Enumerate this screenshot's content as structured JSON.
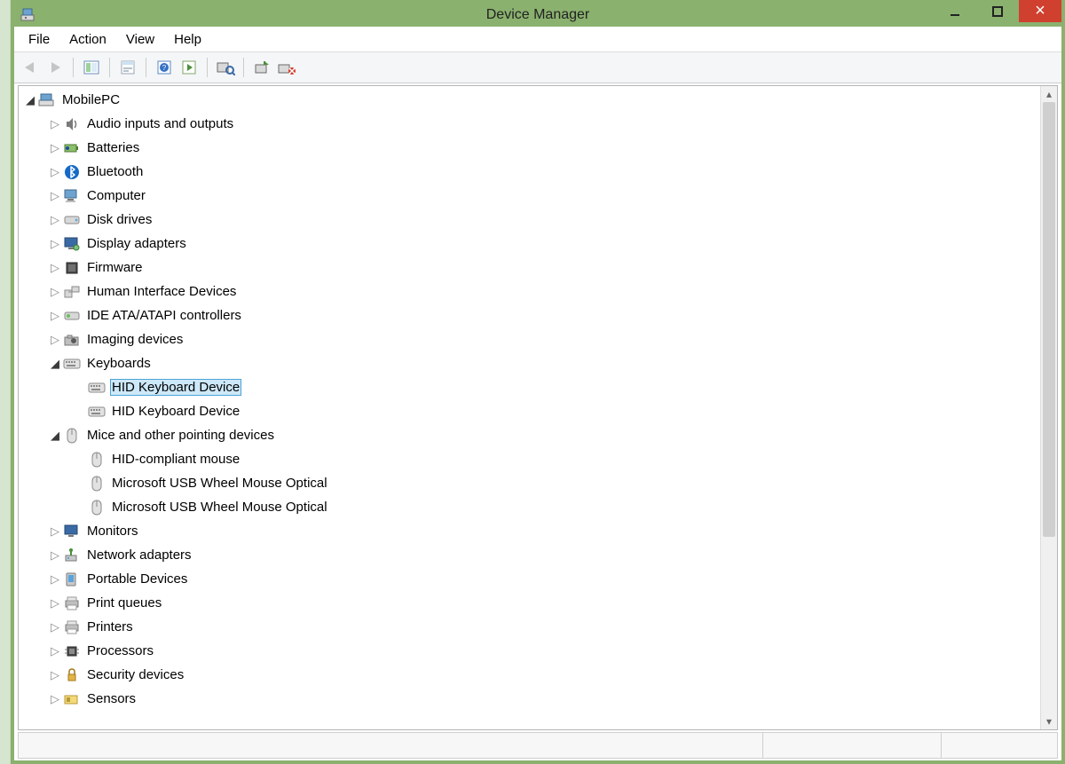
{
  "window": {
    "title": "Device Manager"
  },
  "menus": {
    "file": "File",
    "action": "Action",
    "view": "View",
    "help": "Help"
  },
  "tree": {
    "root": "MobilePC",
    "items": [
      {
        "label": "Audio inputs and outputs",
        "icon": "speaker",
        "state": "collapsed"
      },
      {
        "label": "Batteries",
        "icon": "battery",
        "state": "collapsed"
      },
      {
        "label": "Bluetooth",
        "icon": "bluetooth",
        "state": "collapsed"
      },
      {
        "label": "Computer",
        "icon": "computer",
        "state": "collapsed"
      },
      {
        "label": "Disk drives",
        "icon": "disk",
        "state": "collapsed"
      },
      {
        "label": "Display adapters",
        "icon": "display",
        "state": "collapsed"
      },
      {
        "label": "Firmware",
        "icon": "firmware",
        "state": "collapsed"
      },
      {
        "label": "Human Interface Devices",
        "icon": "hid",
        "state": "collapsed"
      },
      {
        "label": "IDE ATA/ATAPI controllers",
        "icon": "ide",
        "state": "collapsed"
      },
      {
        "label": "Imaging devices",
        "icon": "camera",
        "state": "collapsed"
      },
      {
        "label": "Keyboards",
        "icon": "keyboard",
        "state": "expanded",
        "children": [
          {
            "label": "HID Keyboard Device",
            "icon": "keyboard",
            "selected": true
          },
          {
            "label": "HID Keyboard Device",
            "icon": "keyboard"
          }
        ]
      },
      {
        "label": "Mice and other pointing devices",
        "icon": "mouse",
        "state": "expanded",
        "children": [
          {
            "label": "HID-compliant mouse",
            "icon": "mouse"
          },
          {
            "label": "Microsoft USB Wheel Mouse Optical",
            "icon": "mouse"
          },
          {
            "label": "Microsoft USB Wheel Mouse Optical",
            "icon": "mouse"
          }
        ]
      },
      {
        "label": "Monitors",
        "icon": "monitor",
        "state": "collapsed"
      },
      {
        "label": "Network adapters",
        "icon": "network",
        "state": "collapsed"
      },
      {
        "label": "Portable Devices",
        "icon": "portable",
        "state": "collapsed"
      },
      {
        "label": "Print queues",
        "icon": "printer",
        "state": "collapsed"
      },
      {
        "label": "Printers",
        "icon": "printer",
        "state": "collapsed"
      },
      {
        "label": "Processors",
        "icon": "cpu",
        "state": "collapsed"
      },
      {
        "label": "Security devices",
        "icon": "security",
        "state": "collapsed"
      },
      {
        "label": "Sensors",
        "icon": "sensor",
        "state": "collapsed"
      }
    ]
  }
}
